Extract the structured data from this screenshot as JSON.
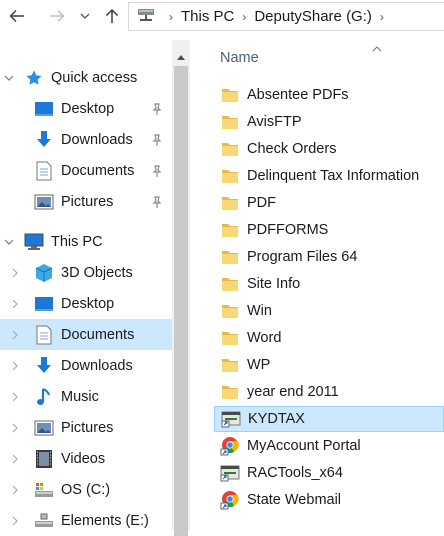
{
  "address_bar": {
    "crumbs": [
      "This PC",
      "DeputyShare (G:)"
    ]
  },
  "file_list": {
    "column_header": "Name",
    "items": [
      {
        "name": "Absentee PDFs",
        "icon": "folder-icon"
      },
      {
        "name": "AvisFTP",
        "icon": "folder-icon"
      },
      {
        "name": "Check Orders",
        "icon": "folder-icon"
      },
      {
        "name": "Delinquent Tax Information",
        "icon": "folder-icon"
      },
      {
        "name": "PDF",
        "icon": "folder-icon"
      },
      {
        "name": "PDFFORMS",
        "icon": "folder-icon"
      },
      {
        "name": "Program Files 64",
        "icon": "folder-icon"
      },
      {
        "name": "Site Info",
        "icon": "folder-icon"
      },
      {
        "name": "Win",
        "icon": "folder-icon"
      },
      {
        "name": "Word",
        "icon": "folder-icon"
      },
      {
        "name": "WP",
        "icon": "folder-icon"
      },
      {
        "name": "year end 2011",
        "icon": "folder-icon"
      },
      {
        "name": "KYDTAX",
        "icon": "app-shortcut-icon",
        "selected": true
      },
      {
        "name": "MyAccount Portal",
        "icon": "chrome-shortcut-icon"
      },
      {
        "name": "RACTools_x64",
        "icon": "app-shortcut-icon"
      },
      {
        "name": "State Webmail",
        "icon": "chrome-shortcut-icon"
      }
    ]
  },
  "nav_pane": {
    "quick_access": {
      "label": "Quick access",
      "items": [
        {
          "label": "Desktop",
          "icon": "desktop-icon",
          "pinned": true
        },
        {
          "label": "Downloads",
          "icon": "downloads-icon",
          "pinned": true
        },
        {
          "label": "Documents",
          "icon": "documents-icon",
          "pinned": true
        },
        {
          "label": "Pictures",
          "icon": "pictures-icon",
          "pinned": true
        }
      ]
    },
    "this_pc": {
      "label": "This PC",
      "items": [
        {
          "label": "3D Objects",
          "icon": "3d-objects-icon"
        },
        {
          "label": "Desktop",
          "icon": "desktop-icon"
        },
        {
          "label": "Documents",
          "icon": "documents-icon",
          "selected": true
        },
        {
          "label": "Downloads",
          "icon": "downloads-icon"
        },
        {
          "label": "Music",
          "icon": "music-icon"
        },
        {
          "label": "Pictures",
          "icon": "pictures-icon"
        },
        {
          "label": "Videos",
          "icon": "videos-icon"
        },
        {
          "label": "OS (C:)",
          "icon": "os-drive-icon"
        },
        {
          "label": "Elements (E:)",
          "icon": "external-drive-icon"
        }
      ]
    }
  },
  "colors": {
    "selection_bg": "#cce8ff",
    "selection_border": "#99d1ff",
    "folder_yellow": "#f8d775",
    "accent_blue": "#1a73e8"
  }
}
